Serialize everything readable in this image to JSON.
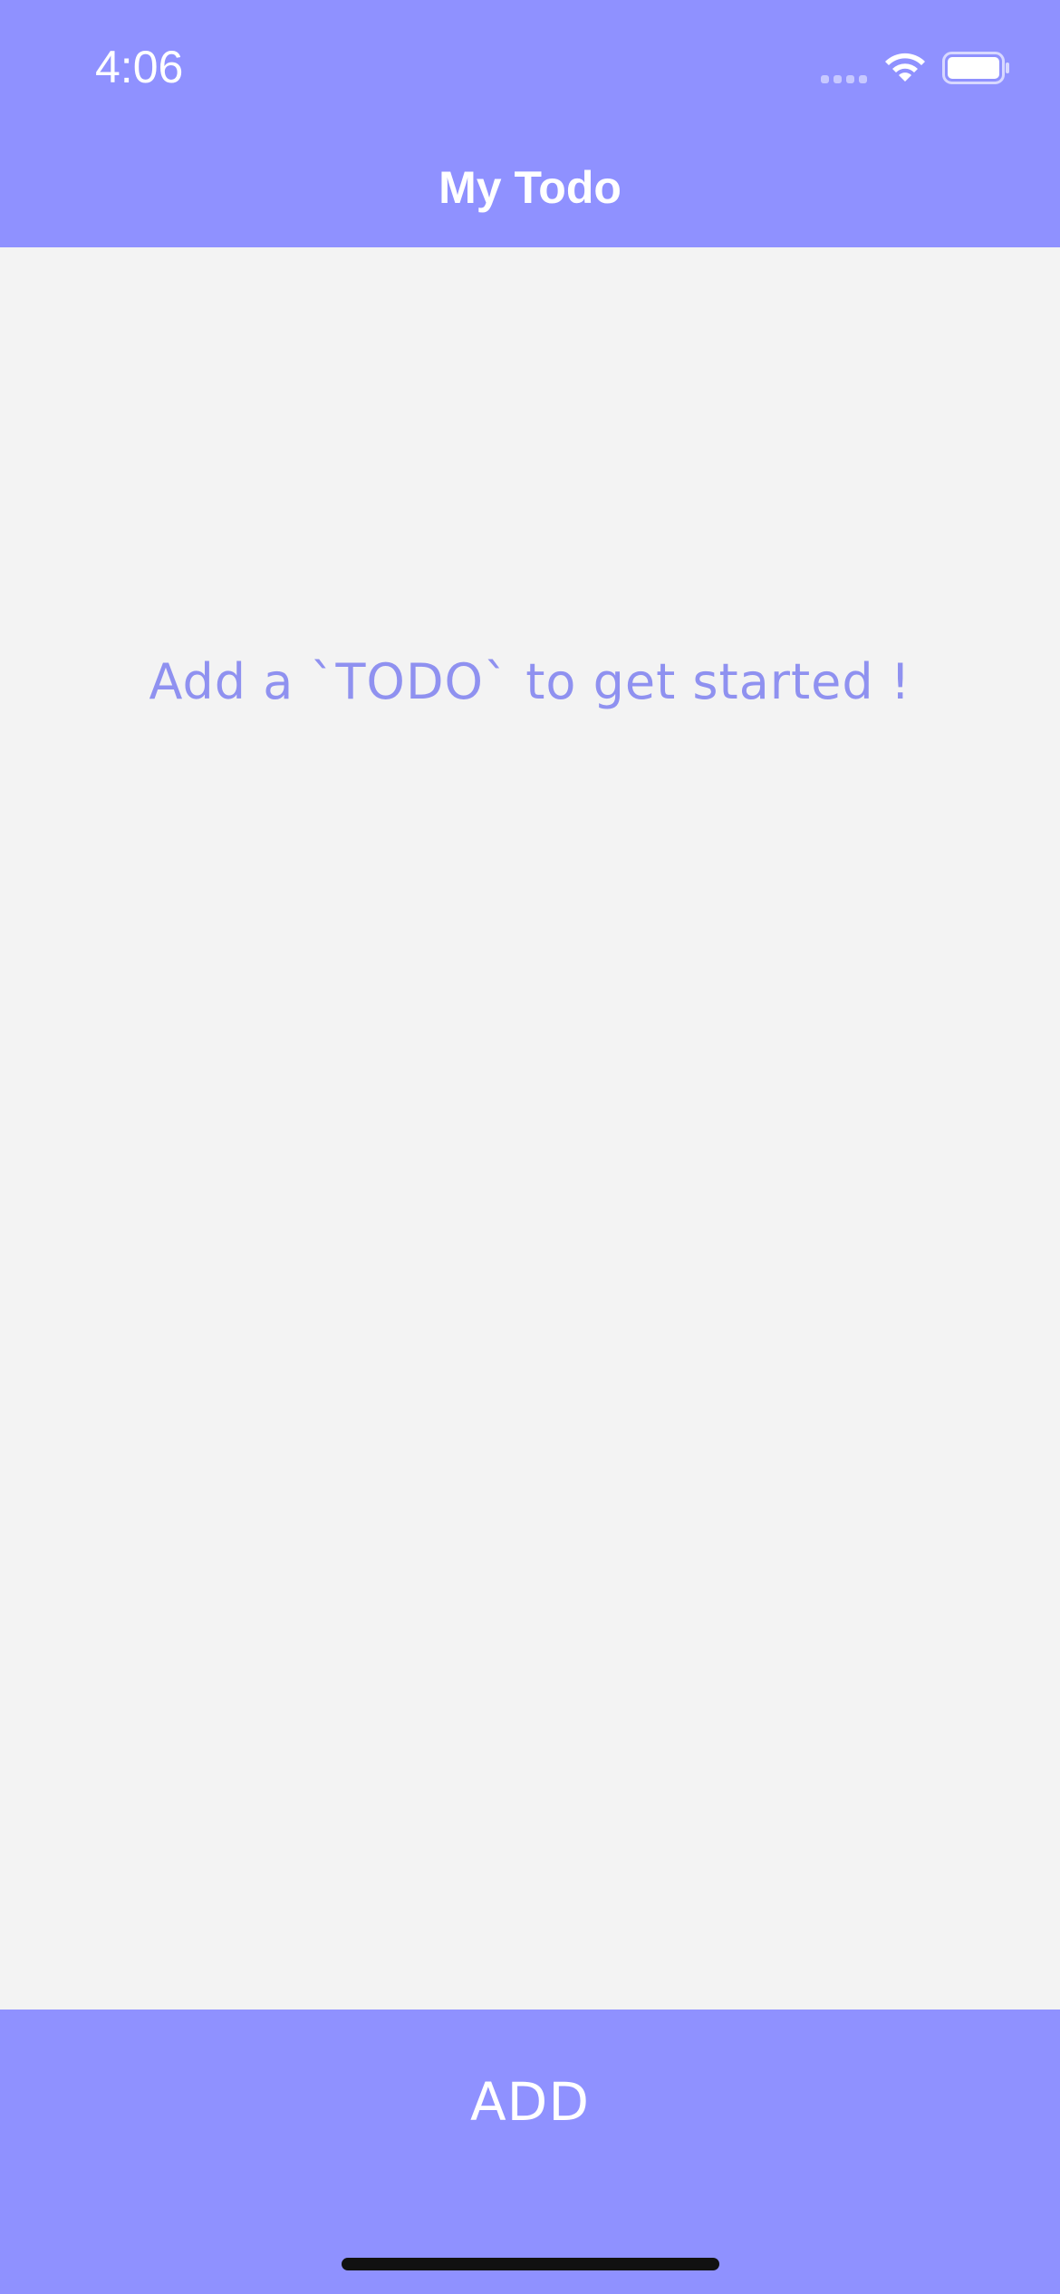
{
  "status_bar": {
    "time": "4:06",
    "icons": [
      "signal-icon",
      "wifi-icon",
      "battery-icon"
    ]
  },
  "nav": {
    "title": "My Todo"
  },
  "main": {
    "empty_message": "Add a `TODO` to get started !"
  },
  "footer": {
    "add_label": "ADD"
  },
  "colors": {
    "accent": "#8f91ff",
    "background": "#f3f3f3",
    "message_text": "#8f91f0",
    "header_text": "#ffffff"
  }
}
